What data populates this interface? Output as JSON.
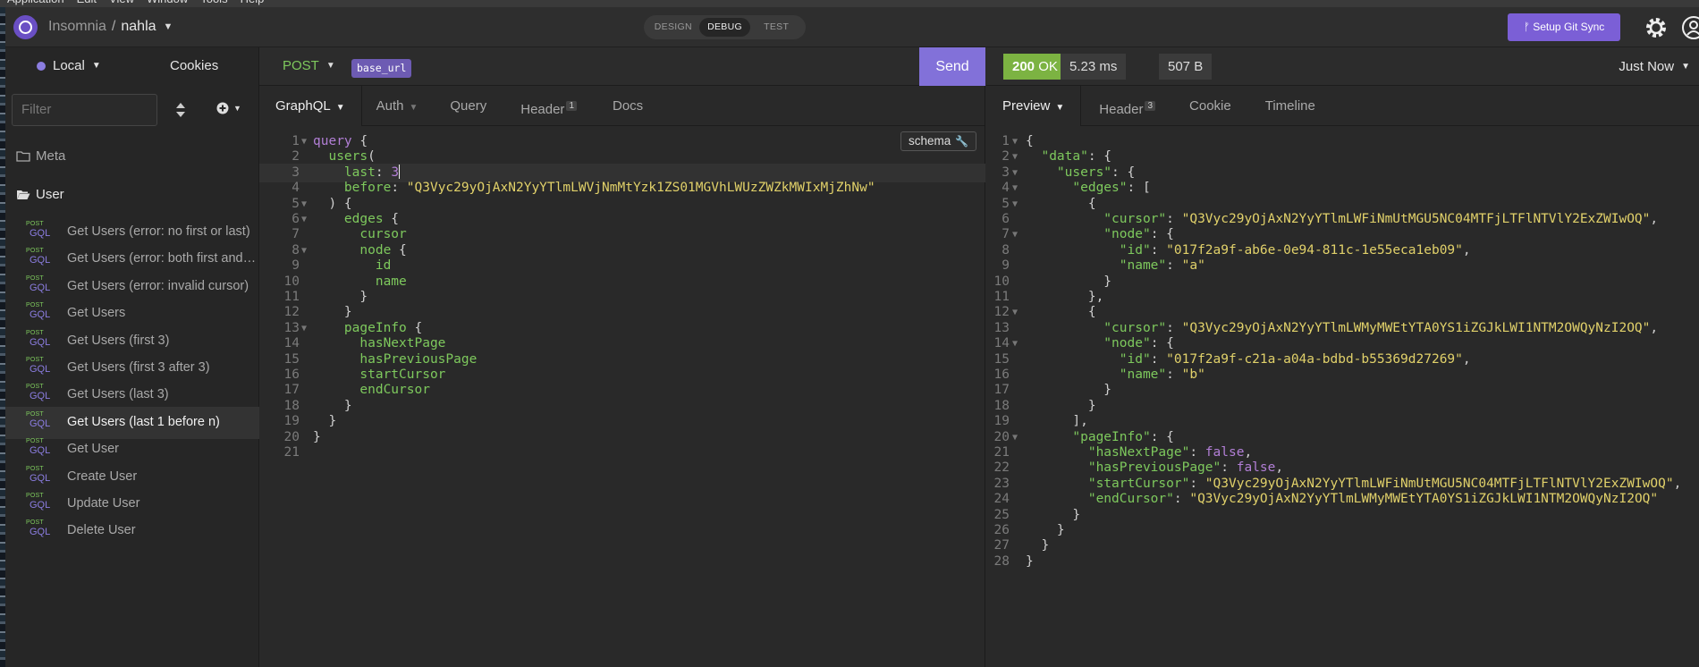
{
  "menubar": {
    "items": [
      "Application",
      "Edit",
      "View",
      "Window",
      "Tools",
      "Help"
    ]
  },
  "header": {
    "app_name": "Insomnia",
    "separator": "/",
    "project": "nahla",
    "modes": [
      "DESIGN",
      "DEBUG",
      "TEST"
    ],
    "active_mode": "DEBUG",
    "git_sync_label": "Setup Git Sync"
  },
  "sidebar": {
    "environment": "Local",
    "cookies_label": "Cookies",
    "filter_placeholder": "Filter",
    "folders": [
      "Meta",
      "User"
    ],
    "requests": [
      {
        "method": "POST",
        "type": "GQL",
        "name": "Get Users (error: no first or last)"
      },
      {
        "method": "POST",
        "type": "GQL",
        "name": "Get Users (error: both first and last)"
      },
      {
        "method": "POST",
        "type": "GQL",
        "name": "Get Users (error: invalid cursor)"
      },
      {
        "method": "POST",
        "type": "GQL",
        "name": "Get Users"
      },
      {
        "method": "POST",
        "type": "GQL",
        "name": "Get Users (first 3)"
      },
      {
        "method": "POST",
        "type": "GQL",
        "name": "Get Users (first 3 after 3)"
      },
      {
        "method": "POST",
        "type": "GQL",
        "name": "Get Users (last 3)"
      },
      {
        "method": "POST",
        "type": "GQL",
        "name": "Get Users (last 1 before n)"
      },
      {
        "method": "POST",
        "type": "GQL",
        "name": "Get User"
      },
      {
        "method": "POST",
        "type": "GQL",
        "name": "Create User"
      },
      {
        "method": "POST",
        "type": "GQL",
        "name": "Update User"
      },
      {
        "method": "POST",
        "type": "GQL",
        "name": "Delete User"
      }
    ],
    "active_request_index": 7
  },
  "request": {
    "method": "POST",
    "url_tag": "base_url",
    "send_label": "Send",
    "tabs": [
      {
        "label": "GraphQL",
        "badge": ""
      },
      {
        "label": "Auth",
        "badge": ""
      },
      {
        "label": "Query",
        "badge": ""
      },
      {
        "label": "Header",
        "badge": "1"
      },
      {
        "label": "Docs",
        "badge": ""
      }
    ],
    "schema_label": "schema",
    "code_lines": [
      [
        [
          "kw",
          "query"
        ],
        [
          "pun",
          " {"
        ]
      ],
      [
        [
          "fld",
          "  users"
        ],
        [
          "pun",
          "("
        ]
      ],
      [
        [
          "fld",
          "    last"
        ],
        [
          "pun",
          ": "
        ],
        [
          "num",
          "3"
        ]
      ],
      [
        [
          "fld",
          "    before"
        ],
        [
          "pun",
          ": "
        ],
        [
          "str",
          "\"Q3Vyc29yOjAxN2YyYTlmLWVjNmMtYzk1ZS01MGVhLWUzZWZkMWIxMjZhNw\""
        ]
      ],
      [
        [
          "pun",
          "  ) {"
        ]
      ],
      [
        [
          "fld",
          "    edges"
        ],
        [
          "pun",
          " {"
        ]
      ],
      [
        [
          "fld",
          "      cursor"
        ]
      ],
      [
        [
          "fld",
          "      node"
        ],
        [
          "pun",
          " {"
        ]
      ],
      [
        [
          "fld",
          "        id"
        ]
      ],
      [
        [
          "fld",
          "        name"
        ]
      ],
      [
        [
          "pun",
          "      }"
        ]
      ],
      [
        [
          "pun",
          "    }"
        ]
      ],
      [
        [
          "fld",
          "    pageInfo"
        ],
        [
          "pun",
          " {"
        ]
      ],
      [
        [
          "fld",
          "      hasNextPage"
        ]
      ],
      [
        [
          "fld",
          "      hasPreviousPage"
        ]
      ],
      [
        [
          "fld",
          "      startCursor"
        ]
      ],
      [
        [
          "fld",
          "      endCursor"
        ]
      ],
      [
        [
          "pun",
          "    }"
        ]
      ],
      [
        [
          "pun",
          "  }"
        ]
      ],
      [
        [
          "pun",
          "}"
        ]
      ],
      []
    ],
    "fold_lines": [
      1,
      5,
      6,
      8,
      13
    ],
    "cursor_line": 3
  },
  "response": {
    "status": "200",
    "status_text": "OK",
    "time": "5.23 ms",
    "size": "507 B",
    "timestamp": "Just Now",
    "tabs": [
      {
        "label": "Preview",
        "badge": ""
      },
      {
        "label": "Header",
        "badge": "3"
      },
      {
        "label": "Cookie",
        "badge": ""
      },
      {
        "label": "Timeline",
        "badge": ""
      }
    ],
    "code_lines": [
      [
        [
          "pun",
          "{"
        ]
      ],
      [
        [
          "key",
          "  \"data\""
        ],
        [
          "pun",
          ": {"
        ]
      ],
      [
        [
          "key",
          "    \"users\""
        ],
        [
          "pun",
          ": {"
        ]
      ],
      [
        [
          "key",
          "      \"edges\""
        ],
        [
          "pun",
          ": ["
        ]
      ],
      [
        [
          "pun",
          "        {"
        ]
      ],
      [
        [
          "key",
          "          \"cursor\""
        ],
        [
          "pun",
          ": "
        ],
        [
          "str",
          "\"Q3Vyc29yOjAxN2YyYTlmLWFiNmUtMGU5NC04MTFjLTFlNTVlY2ExZWIwOQ\""
        ],
        [
          "pun",
          ","
        ]
      ],
      [
        [
          "key",
          "          \"node\""
        ],
        [
          "pun",
          ": {"
        ]
      ],
      [
        [
          "key",
          "            \"id\""
        ],
        [
          "pun",
          ": "
        ],
        [
          "str",
          "\"017f2a9f-ab6e-0e94-811c-1e55eca1eb09\""
        ],
        [
          "pun",
          ","
        ]
      ],
      [
        [
          "key",
          "            \"name\""
        ],
        [
          "pun",
          ": "
        ],
        [
          "str",
          "\"a\""
        ]
      ],
      [
        [
          "pun",
          "          }"
        ]
      ],
      [
        [
          "pun",
          "        },"
        ]
      ],
      [
        [
          "pun",
          "        {"
        ]
      ],
      [
        [
          "key",
          "          \"cursor\""
        ],
        [
          "pun",
          ": "
        ],
        [
          "str",
          "\"Q3Vyc29yOjAxN2YyYTlmLWMyMWEtYTA0YS1iZGJkLWI1NTM2OWQyNzI2OQ\""
        ],
        [
          "pun",
          ","
        ]
      ],
      [
        [
          "key",
          "          \"node\""
        ],
        [
          "pun",
          ": {"
        ]
      ],
      [
        [
          "key",
          "            \"id\""
        ],
        [
          "pun",
          ": "
        ],
        [
          "str",
          "\"017f2a9f-c21a-a04a-bdbd-b55369d27269\""
        ],
        [
          "pun",
          ","
        ]
      ],
      [
        [
          "key",
          "            \"name\""
        ],
        [
          "pun",
          ": "
        ],
        [
          "str",
          "\"b\""
        ]
      ],
      [
        [
          "pun",
          "          }"
        ]
      ],
      [
        [
          "pun",
          "        }"
        ]
      ],
      [
        [
          "pun",
          "      ],"
        ]
      ],
      [
        [
          "key",
          "      \"pageInfo\""
        ],
        [
          "pun",
          ": {"
        ]
      ],
      [
        [
          "key",
          "        \"hasNextPage\""
        ],
        [
          "pun",
          ": "
        ],
        [
          "bool",
          "false"
        ],
        [
          "pun",
          ","
        ]
      ],
      [
        [
          "key",
          "        \"hasPreviousPage\""
        ],
        [
          "pun",
          ": "
        ],
        [
          "bool",
          "false"
        ],
        [
          "pun",
          ","
        ]
      ],
      [
        [
          "key",
          "        \"startCursor\""
        ],
        [
          "pun",
          ": "
        ],
        [
          "str",
          "\"Q3Vyc29yOjAxN2YyYTlmLWFiNmUtMGU5NC04MTFjLTFlNTVlY2ExZWIwOQ\""
        ],
        [
          "pun",
          ","
        ]
      ],
      [
        [
          "key",
          "        \"endCursor\""
        ],
        [
          "pun",
          ": "
        ],
        [
          "str",
          "\"Q3Vyc29yOjAxN2YyYTlmLWMyMWEtYTA0YS1iZGJkLWI1NTM2OWQyNzI2OQ\""
        ]
      ],
      [
        [
          "pun",
          "      }"
        ]
      ],
      [
        [
          "pun",
          "    }"
        ]
      ],
      [
        [
          "pun",
          "  }"
        ]
      ],
      [
        [
          "pun",
          "}"
        ]
      ]
    ],
    "fold_lines": [
      1,
      2,
      3,
      4,
      5,
      7,
      12,
      14,
      20
    ]
  },
  "colors": {
    "accent": "#7b5fd6",
    "send": "#8271d9",
    "ok": "#7cb342",
    "post": "#7ec95d",
    "gql": "#8b7de0"
  }
}
